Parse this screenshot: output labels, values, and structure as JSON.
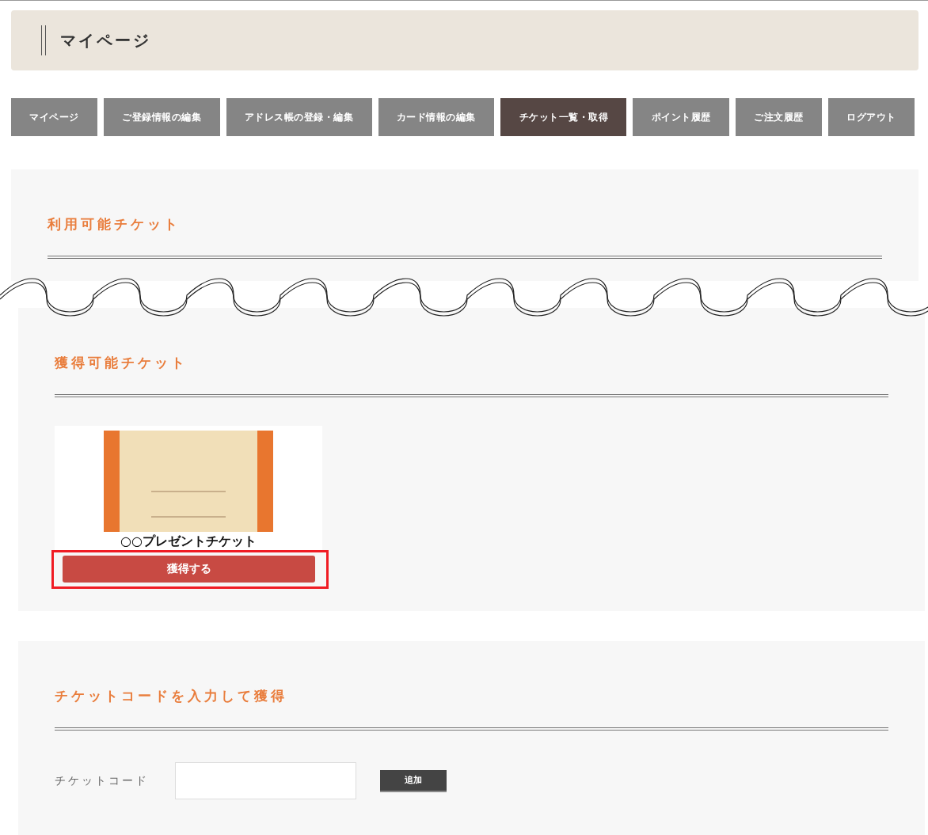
{
  "page_title": "マイページ",
  "nav": [
    {
      "label": "マイページ",
      "selected": false
    },
    {
      "label": "ご登録情報の編集",
      "selected": false
    },
    {
      "label": "アドレス帳の登録・編集",
      "selected": false
    },
    {
      "label": "カード情報の編集",
      "selected": false
    },
    {
      "label": "チケット一覧・取得",
      "selected": true
    },
    {
      "label": "ポイント履歴",
      "selected": false
    },
    {
      "label": "ご注文履歴",
      "selected": false
    },
    {
      "label": "ログアウト",
      "selected": false
    }
  ],
  "available_section": {
    "heading": "利用可能チケット"
  },
  "obtainable_section": {
    "heading": "獲得可能チケット",
    "tickets": [
      {
        "name": "○○プレゼントチケット",
        "button": "獲得する",
        "highlighted": true
      }
    ]
  },
  "code_section": {
    "heading": "チケットコードを入力して獲得",
    "label": "チケットコード",
    "button": "追加"
  }
}
